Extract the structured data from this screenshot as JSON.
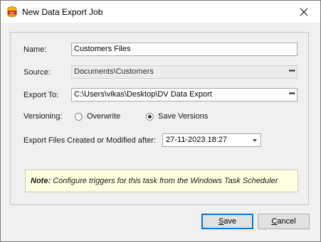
{
  "window": {
    "title": "New Data Export Job",
    "app_icon": "dv-app-icon",
    "close_icon": "close-icon"
  },
  "form": {
    "name_label": "Name:",
    "name_value": "Customers Files",
    "source_label": "Source:",
    "source_value": "Documents\\Customers",
    "export_to_label": "Export To:",
    "export_to_value": "C:\\Users\\vikas\\Desktop\\DV Data Export",
    "browse_glyph": "•••",
    "versioning_label": "Versioning:",
    "versioning_options": [
      {
        "label": "Overwrite",
        "selected": false
      },
      {
        "label": "Save Versions",
        "selected": true
      }
    ],
    "modified_after_label": "Export Files Created or Modified after:",
    "modified_after_value": "27-11-2023 18:27"
  },
  "note": {
    "prefix": "Note:",
    "text": " Configure triggers for this task from the Windows Task Scheduler"
  },
  "buttons": {
    "save_accel": "S",
    "save_rest": "ave",
    "cancel_accel": "C",
    "cancel_rest": "ancel"
  },
  "colors": {
    "accent": "#0078d7",
    "note_bg": "#ffffe1",
    "window_bg": "#f0f0f0"
  }
}
